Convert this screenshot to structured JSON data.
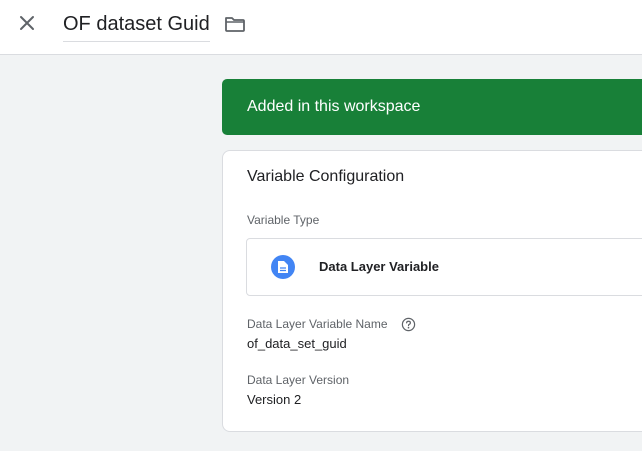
{
  "header": {
    "title": "OF dataset Guid",
    "close_icon": "close-icon",
    "folder_icon": "folder-icon"
  },
  "banner": {
    "text": "Added in this workspace",
    "color": "#188038"
  },
  "config": {
    "title": "Variable Configuration",
    "variable_type_label": "Variable Type",
    "variable_type": "Data Layer Variable",
    "variable_type_icon": "document-icon",
    "variable_type_icon_color": "#4285f4",
    "name_label": "Data Layer Variable Name",
    "name_help_icon": "help-icon",
    "name_value": "of_data_set_guid",
    "version_label": "Data Layer Version",
    "version_value": "Version 2"
  }
}
